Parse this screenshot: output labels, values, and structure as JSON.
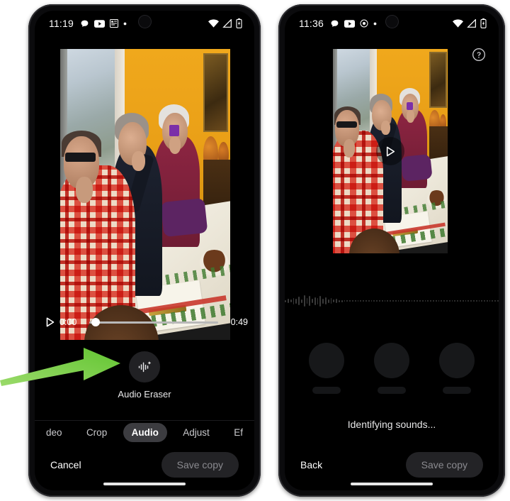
{
  "left_phone": {
    "status_bar": {
      "time": "11:19",
      "icons": [
        "chat-bubble-icon",
        "youtube-icon",
        "app-icon",
        "dot-icon"
      ],
      "right_icons": [
        "wifi-icon",
        "signal-icon",
        "battery-icon"
      ]
    },
    "player": {
      "play_icon": "play-icon",
      "current_time": "0:00",
      "duration": "0:49",
      "progress_percent": 3
    },
    "tool": {
      "icon": "audio-waveform-sparkle-icon",
      "label": "Audio Eraser"
    },
    "tabs": [
      {
        "label": "deo",
        "selected": false,
        "clipped": true
      },
      {
        "label": "Crop",
        "selected": false,
        "clipped": false
      },
      {
        "label": "Audio",
        "selected": true,
        "clipped": false
      },
      {
        "label": "Adjust",
        "selected": false,
        "clipped": false
      },
      {
        "label": "Ef",
        "selected": false,
        "clipped": true
      }
    ],
    "actions": {
      "cancel_label": "Cancel",
      "save_label": "Save copy"
    }
  },
  "right_phone": {
    "status_bar": {
      "time": "11:36",
      "icons": [
        "chat-bubble-icon",
        "youtube-icon",
        "chrome-icon",
        "dot-icon"
      ],
      "right_icons": [
        "wifi-icon",
        "signal-icon",
        "battery-icon"
      ]
    },
    "help_icon": "help-circle-icon",
    "preview": {
      "play_icon": "play-icon"
    },
    "waveform": {
      "name": "audio-waveform",
      "amplitudes": [
        3,
        6,
        4,
        9,
        7,
        12,
        5,
        16,
        8,
        14,
        6,
        11,
        9,
        15,
        7,
        10,
        5,
        8,
        4,
        6,
        3,
        3,
        2,
        2,
        2,
        2,
        2,
        2,
        2,
        2,
        2,
        2,
        2,
        2,
        2,
        2,
        2,
        2,
        2,
        2,
        2,
        2,
        2,
        2,
        2,
        2,
        2,
        2,
        2,
        2,
        2,
        2,
        2,
        2,
        2,
        2,
        2,
        2,
        2,
        2,
        2,
        2,
        2,
        2,
        2,
        2,
        2,
        2,
        2,
        2,
        2,
        2,
        2,
        2,
        2,
        2,
        2,
        2,
        2,
        2
      ]
    },
    "loading_placeholders": 3,
    "status_text": "Identifying sounds...",
    "actions": {
      "back_label": "Back",
      "save_label": "Save copy"
    }
  },
  "annotation": {
    "arrow_color": "#7ed04a",
    "name": "green-pointer-arrow"
  }
}
